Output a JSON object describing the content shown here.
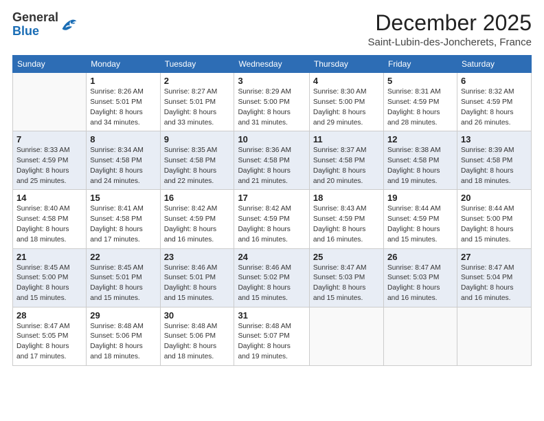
{
  "logo": {
    "general": "General",
    "blue": "Blue"
  },
  "title": "December 2025",
  "location": "Saint-Lubin-des-Joncherets, France",
  "weekdays": [
    "Sunday",
    "Monday",
    "Tuesday",
    "Wednesday",
    "Thursday",
    "Friday",
    "Saturday"
  ],
  "weeks": [
    [
      {
        "day": "",
        "info": ""
      },
      {
        "day": "1",
        "info": "Sunrise: 8:26 AM\nSunset: 5:01 PM\nDaylight: 8 hours\nand 34 minutes."
      },
      {
        "day": "2",
        "info": "Sunrise: 8:27 AM\nSunset: 5:01 PM\nDaylight: 8 hours\nand 33 minutes."
      },
      {
        "day": "3",
        "info": "Sunrise: 8:29 AM\nSunset: 5:00 PM\nDaylight: 8 hours\nand 31 minutes."
      },
      {
        "day": "4",
        "info": "Sunrise: 8:30 AM\nSunset: 5:00 PM\nDaylight: 8 hours\nand 29 minutes."
      },
      {
        "day": "5",
        "info": "Sunrise: 8:31 AM\nSunset: 4:59 PM\nDaylight: 8 hours\nand 28 minutes."
      },
      {
        "day": "6",
        "info": "Sunrise: 8:32 AM\nSunset: 4:59 PM\nDaylight: 8 hours\nand 26 minutes."
      }
    ],
    [
      {
        "day": "7",
        "info": "Sunrise: 8:33 AM\nSunset: 4:59 PM\nDaylight: 8 hours\nand 25 minutes."
      },
      {
        "day": "8",
        "info": "Sunrise: 8:34 AM\nSunset: 4:58 PM\nDaylight: 8 hours\nand 24 minutes."
      },
      {
        "day": "9",
        "info": "Sunrise: 8:35 AM\nSunset: 4:58 PM\nDaylight: 8 hours\nand 22 minutes."
      },
      {
        "day": "10",
        "info": "Sunrise: 8:36 AM\nSunset: 4:58 PM\nDaylight: 8 hours\nand 21 minutes."
      },
      {
        "day": "11",
        "info": "Sunrise: 8:37 AM\nSunset: 4:58 PM\nDaylight: 8 hours\nand 20 minutes."
      },
      {
        "day": "12",
        "info": "Sunrise: 8:38 AM\nSunset: 4:58 PM\nDaylight: 8 hours\nand 19 minutes."
      },
      {
        "day": "13",
        "info": "Sunrise: 8:39 AM\nSunset: 4:58 PM\nDaylight: 8 hours\nand 18 minutes."
      }
    ],
    [
      {
        "day": "14",
        "info": "Sunrise: 8:40 AM\nSunset: 4:58 PM\nDaylight: 8 hours\nand 18 minutes."
      },
      {
        "day": "15",
        "info": "Sunrise: 8:41 AM\nSunset: 4:58 PM\nDaylight: 8 hours\nand 17 minutes."
      },
      {
        "day": "16",
        "info": "Sunrise: 8:42 AM\nSunset: 4:59 PM\nDaylight: 8 hours\nand 16 minutes."
      },
      {
        "day": "17",
        "info": "Sunrise: 8:42 AM\nSunset: 4:59 PM\nDaylight: 8 hours\nand 16 minutes."
      },
      {
        "day": "18",
        "info": "Sunrise: 8:43 AM\nSunset: 4:59 PM\nDaylight: 8 hours\nand 16 minutes."
      },
      {
        "day": "19",
        "info": "Sunrise: 8:44 AM\nSunset: 4:59 PM\nDaylight: 8 hours\nand 15 minutes."
      },
      {
        "day": "20",
        "info": "Sunrise: 8:44 AM\nSunset: 5:00 PM\nDaylight: 8 hours\nand 15 minutes."
      }
    ],
    [
      {
        "day": "21",
        "info": "Sunrise: 8:45 AM\nSunset: 5:00 PM\nDaylight: 8 hours\nand 15 minutes."
      },
      {
        "day": "22",
        "info": "Sunrise: 8:45 AM\nSunset: 5:01 PM\nDaylight: 8 hours\nand 15 minutes."
      },
      {
        "day": "23",
        "info": "Sunrise: 8:46 AM\nSunset: 5:01 PM\nDaylight: 8 hours\nand 15 minutes."
      },
      {
        "day": "24",
        "info": "Sunrise: 8:46 AM\nSunset: 5:02 PM\nDaylight: 8 hours\nand 15 minutes."
      },
      {
        "day": "25",
        "info": "Sunrise: 8:47 AM\nSunset: 5:03 PM\nDaylight: 8 hours\nand 15 minutes."
      },
      {
        "day": "26",
        "info": "Sunrise: 8:47 AM\nSunset: 5:03 PM\nDaylight: 8 hours\nand 16 minutes."
      },
      {
        "day": "27",
        "info": "Sunrise: 8:47 AM\nSunset: 5:04 PM\nDaylight: 8 hours\nand 16 minutes."
      }
    ],
    [
      {
        "day": "28",
        "info": "Sunrise: 8:47 AM\nSunset: 5:05 PM\nDaylight: 8 hours\nand 17 minutes."
      },
      {
        "day": "29",
        "info": "Sunrise: 8:48 AM\nSunset: 5:06 PM\nDaylight: 8 hours\nand 18 minutes."
      },
      {
        "day": "30",
        "info": "Sunrise: 8:48 AM\nSunset: 5:06 PM\nDaylight: 8 hours\nand 18 minutes."
      },
      {
        "day": "31",
        "info": "Sunrise: 8:48 AM\nSunset: 5:07 PM\nDaylight: 8 hours\nand 19 minutes."
      },
      {
        "day": "",
        "info": ""
      },
      {
        "day": "",
        "info": ""
      },
      {
        "day": "",
        "info": ""
      }
    ]
  ]
}
